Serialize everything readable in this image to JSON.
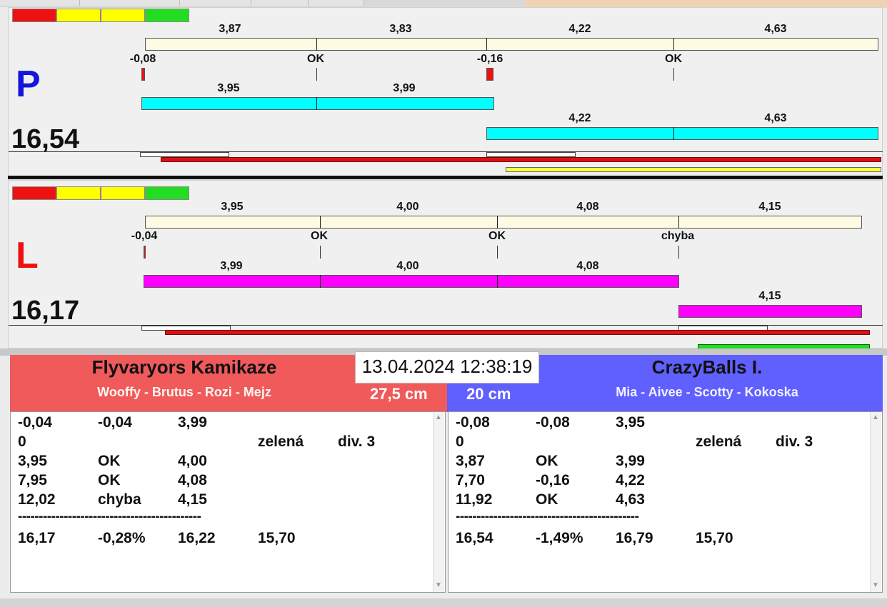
{
  "colors": {
    "red": "#ee1111",
    "yellow": "#ffff00",
    "green": "#22dd22",
    "cream": "#fefbe3",
    "cyan": "#00ffff",
    "magenta": "#ff00ff",
    "team_left_bg": "#f05a5a",
    "team_right_bg": "#6060ff",
    "p_color": "#1515dd",
    "l_color": "#ee1111"
  },
  "lane_p": {
    "letter": "P",
    "total": "16,54",
    "lights": [
      "red",
      "yellow",
      "yellow",
      "green"
    ],
    "split_labels": [
      "3,87",
      "3,83",
      "4,22",
      "4,63"
    ],
    "status_labels": [
      "-0,08",
      "OK",
      "-0,16",
      "OK"
    ],
    "run1_labels": [
      "3,95",
      "3,99"
    ],
    "run2_labels": [
      "4,22",
      "4,63"
    ]
  },
  "lane_l": {
    "letter": "L",
    "total": "16,17",
    "lights": [
      "red",
      "yellow",
      "yellow",
      "green"
    ],
    "split_labels": [
      "3,95",
      "4,00",
      "4,08",
      "4,15"
    ],
    "status_labels": [
      "-0,04",
      "OK",
      "OK",
      "chyba"
    ],
    "run1_labels": [
      "3,99",
      "4,00",
      "4,08"
    ],
    "run2_labels": [
      "4,15"
    ]
  },
  "datetime": "13.04.2024 12:38:19",
  "left_team": {
    "name": "Flyvaryors Kamikaze",
    "members": "Wooffy - Brutus - Rozi - Mejz",
    "box": "27,5 cm",
    "rows": [
      [
        "-0,04",
        "-0,04",
        "3,99",
        "",
        ""
      ],
      [
        "0",
        "",
        "",
        "zelená",
        "div. 3"
      ],
      [
        "3,95",
        "OK",
        "4,00",
        "",
        ""
      ],
      [
        "7,95",
        "OK",
        "4,08",
        "",
        ""
      ],
      [
        "12,02",
        "chyba",
        "4,15",
        "",
        ""
      ]
    ],
    "separator": "--------------------------------------------",
    "summary": [
      "16,17",
      "-0,28%",
      "16,22",
      "15,70"
    ]
  },
  "right_team": {
    "name": "CrazyBalls I.",
    "members": "Mia - Aivee - Scotty - Kokoska",
    "box": "20 cm",
    "rows": [
      [
        "-0,08",
        "-0,08",
        "3,95",
        "",
        ""
      ],
      [
        "0",
        "",
        "",
        "zelená",
        "div. 3"
      ],
      [
        "3,87",
        "OK",
        "3,99",
        "",
        ""
      ],
      [
        "7,70",
        "-0,16",
        "4,22",
        "",
        ""
      ],
      [
        "11,92",
        "OK",
        "4,63",
        "",
        ""
      ]
    ],
    "separator": "--------------------------------------------",
    "summary": [
      "16,54",
      "-1,49%",
      "16,79",
      "15,70"
    ]
  }
}
